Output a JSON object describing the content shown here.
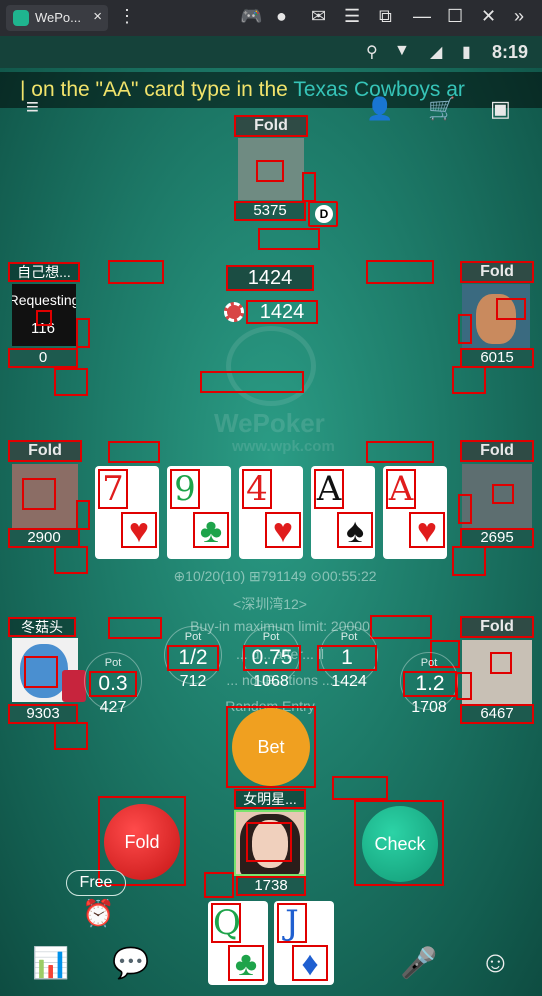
{
  "emulator": {
    "tab_title": "WePo...",
    "tab_close": "×",
    "icons": [
      "more-icon",
      "gamepad-icon",
      "account-icon",
      "mail-icon",
      "menu-icon",
      "resize-icon",
      "minimize-icon",
      "maximize-icon",
      "close-icon",
      "sidebar-collapse-icon"
    ]
  },
  "statusbar": {
    "time": "8:19"
  },
  "marquee": {
    "text_a": "| on the \"AA\" card type in the ",
    "text_b": "Texas Cowboys ar"
  },
  "watermark": {
    "brand": "WePoker",
    "url": "www.wpk.com"
  },
  "pot": {
    "main": "1424",
    "sub": "1424"
  },
  "players": {
    "top": {
      "tag": "Fold",
      "chips": "5375",
      "dealer": "D"
    },
    "left_upper": {
      "name": "自己想...",
      "status": "Requesting",
      "timer": "116",
      "chips": "0"
    },
    "right_upper": {
      "tag": "Fold",
      "chips": "6015"
    },
    "left_middle": {
      "tag": "Fold",
      "chips": "2900"
    },
    "right_middle": {
      "tag": "Fold",
      "chips": "2695"
    },
    "left_lower": {
      "name": "冬菇头",
      "chips": "9303"
    },
    "right_lower": {
      "tag": "Fold",
      "chips": "6467"
    },
    "hero": {
      "name": "女明星...",
      "chips": "1738"
    }
  },
  "community_cards": [
    {
      "rank": "7",
      "suit": "♥",
      "color": "#e01c1c"
    },
    {
      "rank": "9",
      "suit": "♣",
      "color": "#1ea34a"
    },
    {
      "rank": "4",
      "suit": "♥",
      "color": "#e01c1c"
    },
    {
      "rank": "A",
      "suit": "♠",
      "color": "#111111"
    },
    {
      "rank": "A",
      "suit": "♥",
      "color": "#e01c1c"
    }
  ],
  "hole_cards": [
    {
      "rank": "Q",
      "suit": "♣",
      "color": "#1ea34a"
    },
    {
      "rank": "J",
      "suit": "♦",
      "color": "#1f5fd0"
    }
  ],
  "table_info": {
    "stats": "⊕10/20(10)  ⊞791149  ⊙00:55:22",
    "room": "<深圳湾12>",
    "line1": "Buy-in maximum limit: 20000",
    "line2": "... d... after... ll",
    "line3": "... nd IP... tions ...",
    "line4": "Random Entry"
  },
  "bet_sizes": {
    "left": {
      "label": "Pot",
      "frac": "0.3",
      "amount": "427"
    },
    "b1": {
      "label": "Pot",
      "frac": "1/2",
      "amount": "712"
    },
    "b2": {
      "label": "Pot",
      "frac": "0.75",
      "amount": "1068"
    },
    "b3": {
      "label": "Pot",
      "frac": "1",
      "amount": "1424"
    },
    "right": {
      "label": "Pot",
      "frac": "1.2",
      "amount": "1708"
    }
  },
  "actions": {
    "bet": "Bet",
    "fold": "Fold",
    "check": "Check",
    "free": "Free"
  },
  "bottom_bar": [
    "stats-icon",
    "chat-icon",
    "microphone-icon",
    "emoji-icon"
  ],
  "colors": {
    "table": "#1d7a68",
    "fold_btn": "#d81e1e",
    "bet_btn": "#f0a020",
    "check_btn": "#1ca783",
    "highlight": "#e00000"
  }
}
